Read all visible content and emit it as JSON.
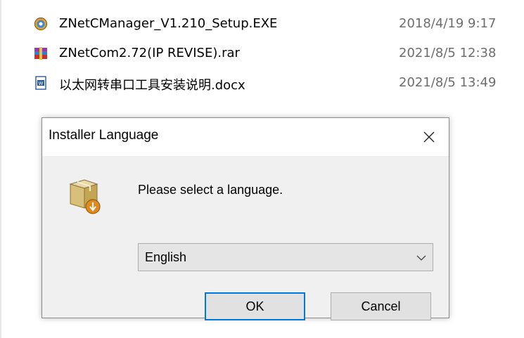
{
  "explorer": {
    "files": [
      {
        "name": "ZNetCManager_V1.210_Setup.EXE",
        "date": "2018/4/19 9:17",
        "icon": "setup-exe-icon"
      },
      {
        "name": "ZNetCom2.72(IP REVISE).rar",
        "date": "2021/8/5 12:38",
        "icon": "winrar-archive-icon"
      },
      {
        "name": "以太网转串口工具安装说明.docx",
        "date": "2021/8/5 13:49",
        "icon": "word-document-icon"
      }
    ]
  },
  "dialog": {
    "title": "Installer Language",
    "prompt": "Please select a language.",
    "language_select": {
      "selected": "English"
    },
    "ok_label": "OK",
    "cancel_label": "Cancel"
  },
  "colors": {
    "dialog_bg": "#f0f0f0",
    "button_bg": "#e1e1e1",
    "focus_border": "#0078d7",
    "date_text": "#6d6d6d"
  }
}
